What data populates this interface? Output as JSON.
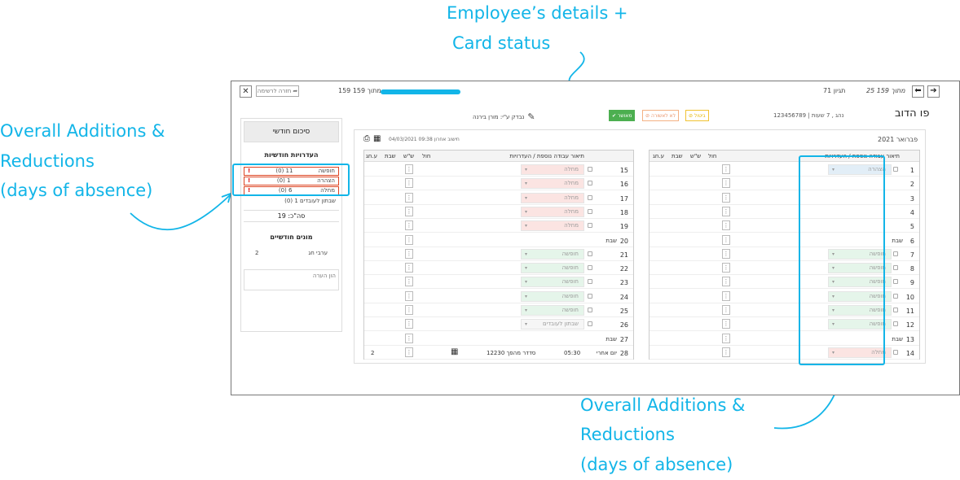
{
  "annotations": {
    "top_line1": "Employee’s details +",
    "top_line2": "Card status",
    "left_line1": "Overall Additions &",
    "left_line2": "Reductions",
    "left_line3": "(days of absence)",
    "bottom_line1": "Overall Additions &",
    "bottom_line2": "Reductions",
    "bottom_line3": "(days of absence)",
    "color": "#12b5e8"
  },
  "topbar": {
    "close_icon": "✕",
    "back_label": "חזרה לרשימה",
    "progress_text": "159 מתוך 159",
    "progress_percent": 100,
    "page_text": "25 מתוך 159",
    "inventory_text": "71 תגיון"
  },
  "employee": {
    "name": "פו הדוב",
    "details": "123456789 | נהג , 7 שעות",
    "checked_by": "נבדק ע\"י: מורן בירנה"
  },
  "status_buttons": {
    "approve": "מאושר",
    "reject": "לא לאשורה",
    "cancel": "ביטול"
  },
  "sidebar": {
    "title": "סיכום חודשי",
    "absences_title": "העדרויות חודשיות",
    "absences": [
      {
        "label": "חופשה",
        "value": "11 (0)",
        "flag": "!"
      },
      {
        "label": "הצהרה",
        "value": "1 (0)",
        "flag": "!"
      },
      {
        "label": "מחלה",
        "value": "6 (0)",
        "flag": "!"
      }
    ],
    "extra_absence": "שבתון לעובדים 1 (0)",
    "total": "סה\"כ: 19",
    "counters_title": "מונים חודשיים",
    "counters": [
      {
        "label": "ערבי חג",
        "value": "2"
      }
    ],
    "note_placeholder": "הון הערה"
  },
  "main": {
    "month": "פברואר 2021",
    "last_calc": "חישוב אחרון 09:38 04/03/2021",
    "col_headers": {
      "desc": "תיאור עבודה נוספת / העדרויות",
      "hol": "חול",
      "shish": "ש\"ש",
      "shabat": "שבת",
      "ehag": "ע.חג"
    },
    "right_rows": [
      {
        "day": "1",
        "label": "",
        "status": "הצהרה",
        "color": "#e2eef7"
      },
      {
        "day": "2",
        "label": "",
        "status": "",
        "color": ""
      },
      {
        "day": "3",
        "label": "",
        "status": "",
        "color": ""
      },
      {
        "day": "4",
        "label": "",
        "status": "",
        "color": ""
      },
      {
        "day": "5",
        "label": "",
        "status": "",
        "color": ""
      },
      {
        "day": "6",
        "label": "שבת",
        "status": "",
        "color": ""
      },
      {
        "day": "7",
        "label": "",
        "status": "חופשה",
        "color": "#e5f5ea"
      },
      {
        "day": "8",
        "label": "",
        "status": "חופשה",
        "color": "#e5f5ea"
      },
      {
        "day": "9",
        "label": "",
        "status": "חופשה",
        "color": "#e5f5ea"
      },
      {
        "day": "10",
        "label": "",
        "status": "חופשה",
        "color": "#e5f5ea"
      },
      {
        "day": "11",
        "label": "",
        "status": "חופשה",
        "color": "#e5f5ea"
      },
      {
        "day": "12",
        "label": "",
        "status": "חופשה",
        "color": "#e5f5ea"
      },
      {
        "day": "13",
        "label": "שבת",
        "status": "",
        "color": ""
      },
      {
        "day": "14",
        "label": "",
        "status": "מחלה",
        "color": "#fbe4e2"
      }
    ],
    "left_rows": [
      {
        "day": "15",
        "label": "",
        "status": "מחלה",
        "color": "#fbe4e2"
      },
      {
        "day": "16",
        "label": "",
        "status": "מחלה",
        "color": "#fbe4e2"
      },
      {
        "day": "17",
        "label": "",
        "status": "מחלה",
        "color": "#fbe4e2"
      },
      {
        "day": "18",
        "label": "",
        "status": "מחלה",
        "color": "#fbe4e2"
      },
      {
        "day": "19",
        "label": "",
        "status": "מחלה",
        "color": "#fbe4e2"
      },
      {
        "day": "20",
        "label": "שבת",
        "status": "",
        "color": ""
      },
      {
        "day": "21",
        "label": "",
        "status": "חופשה",
        "color": "#e5f5ea"
      },
      {
        "day": "22",
        "label": "",
        "status": "חופשה",
        "color": "#e5f5ea"
      },
      {
        "day": "23",
        "label": "",
        "status": "חופשה",
        "color": "#e5f5ea"
      },
      {
        "day": "24",
        "label": "",
        "status": "חופשה",
        "color": "#e5f5ea"
      },
      {
        "day": "25",
        "label": "",
        "status": "חופשה",
        "color": "#e5f5ea"
      },
      {
        "day": "26",
        "label": "",
        "status": "שבתון לעובדים",
        "color": "#f6f6f6"
      },
      {
        "day": "27",
        "label": "שבת",
        "status": "",
        "color": ""
      },
      {
        "day": "28",
        "label": "יום אחרי",
        "status": "",
        "color": ""
      }
    ],
    "last_row": {
      "time": "05:30",
      "worker": "סדדר מהפך 12230",
      "ehag": "2"
    }
  }
}
